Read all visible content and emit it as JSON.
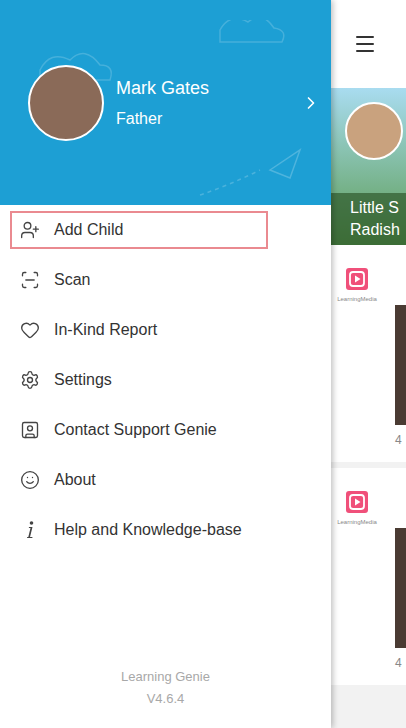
{
  "drawer": {
    "user": {
      "name": "Mark Gates",
      "role": "Father"
    },
    "menu": [
      {
        "label": "Add Child",
        "kind": "add-child",
        "highlighted": true
      },
      {
        "label": "Scan",
        "kind": "scan",
        "highlighted": false
      },
      {
        "label": "In-Kind Report",
        "kind": "heart",
        "highlighted": false
      },
      {
        "label": "Settings",
        "kind": "settings",
        "highlighted": false
      },
      {
        "label": "Contact Support Genie",
        "kind": "contact",
        "highlighted": false
      },
      {
        "label": "About",
        "kind": "about",
        "highlighted": false
      },
      {
        "label": "Help and Knowledge-base",
        "kind": "info",
        "highlighted": false
      }
    ],
    "footer": {
      "app": "Learning Genie",
      "version": "V4.6.4"
    }
  },
  "background": {
    "child": {
      "name_lines": [
        "Little S",
        "Radish"
      ]
    },
    "feed": [
      {
        "source": "LearningMedia",
        "count": "4"
      },
      {
        "source": "LearningMedia",
        "count": "4"
      }
    ]
  }
}
